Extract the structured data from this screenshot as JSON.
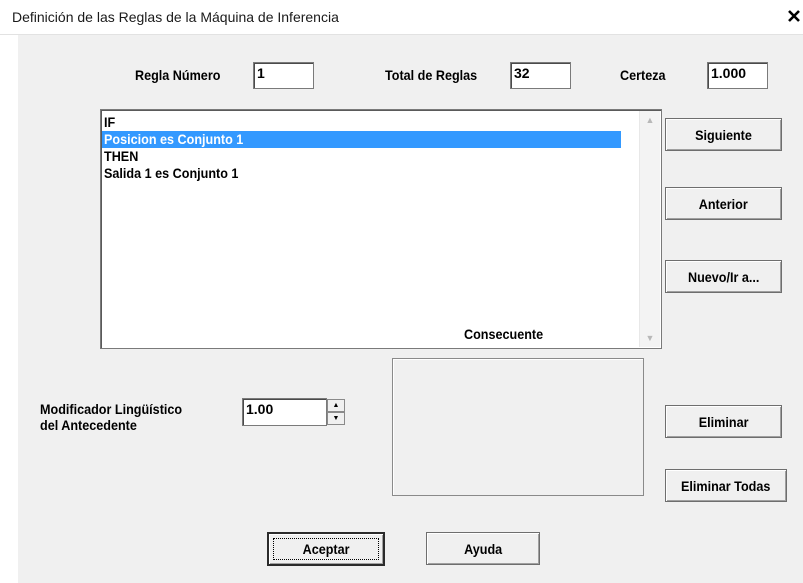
{
  "window": {
    "title": "Definición de las Reglas de la Máquina de Inferencia",
    "close_glyph": "✕"
  },
  "fields": {
    "regla_numero_label": "Regla Número",
    "regla_numero_value": "1",
    "total_reglas_label": "Total de Reglas",
    "total_reglas_value": "32",
    "certeza_label": "Certeza",
    "certeza_value": "1.000"
  },
  "rule_list": {
    "items": [
      {
        "text": "IF",
        "selected": false
      },
      {
        "text": "Posicion es Conjunto 1",
        "selected": true
      },
      {
        "text": "THEN",
        "selected": false
      },
      {
        "text": "Salida 1 es Conjunto 1",
        "selected": false
      }
    ]
  },
  "consecuente": {
    "label": "Consecuente"
  },
  "modifier": {
    "label_line1": "Modificador Lingüístico",
    "label_line2": "del Antecedente",
    "value": "1.00"
  },
  "buttons": {
    "siguiente": "Siguiente",
    "anterior": "Anterior",
    "nuevo": "Nuevo/Ir a...",
    "eliminar": "Eliminar",
    "eliminar_todas": "Eliminar Todas",
    "aceptar": "Aceptar",
    "ayuda": "Ayuda"
  },
  "icons": {
    "close": "close-icon",
    "scroll_up": "scroll-up-arrow-icon",
    "scroll_down": "scroll-down-arrow-icon",
    "spin_up": "spin-up-arrow-icon",
    "spin_down": "spin-down-arrow-icon"
  },
  "colors": {
    "selection": "#3399ff",
    "dialog_bg": "#f0f0f0"
  }
}
